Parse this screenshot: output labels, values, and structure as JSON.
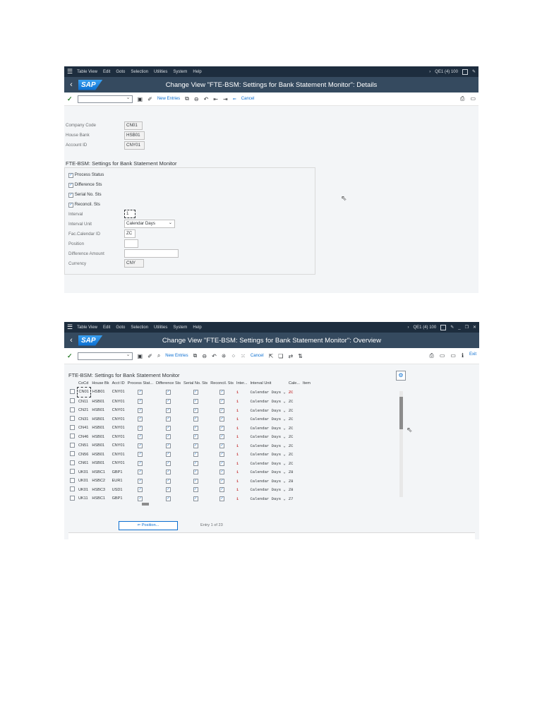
{
  "screen1": {
    "menu": [
      "Table View",
      "Edit",
      "Goto",
      "Selection",
      "Utilities",
      "System",
      "Help"
    ],
    "system_info": "QE1 (4) 100",
    "title": "Change View \"FTE-BSM: Settings for Bank Statement Monitor\": Details",
    "logo": "SAP",
    "toolbar": {
      "new_entries": "New Entries",
      "cancel": "Cancel"
    },
    "header_fields": [
      {
        "label": "Company Code",
        "value": "CN01"
      },
      {
        "label": "House Bank",
        "value": "HSB01"
      },
      {
        "label": "Account ID",
        "value": "CNY01"
      }
    ],
    "group_title": "FTE-BSM: Settings for Bank Statement Monitor",
    "checkboxes": [
      {
        "label": "Process Status",
        "checked": true
      },
      {
        "label": "Difference Sts",
        "checked": true
      },
      {
        "label": "Serial No. Sts",
        "checked": true
      },
      {
        "label": "Reconcil. Sts",
        "checked": true
      }
    ],
    "fields": {
      "interval": {
        "label": "Interval",
        "value": "1"
      },
      "interval_unit": {
        "label": "Interval Unit",
        "value": "Calendar Days"
      },
      "fac_calendar": {
        "label": "Fac.Calendar ID",
        "value": "ZC"
      },
      "position": {
        "label": "Position",
        "value": ""
      },
      "difference_amount": {
        "label": "Difference Amount",
        "value": ""
      },
      "currency": {
        "label": "Currency",
        "value": "CNY"
      }
    }
  },
  "screen2": {
    "menu": [
      "Table View",
      "Edit",
      "Goto",
      "Selection",
      "Utilities",
      "System",
      "Help"
    ],
    "system_info": "QE1 (4) 100",
    "title": "Change View \"FTE-BSM: Settings for Bank Statement Monitor\": Overview",
    "logo": "SAP",
    "toolbar": {
      "new_entries": "New Entries",
      "cancel": "Cancel",
      "exit": "Exit"
    },
    "table_title": "FTE-BSM: Settings for Bank Statement Monitor",
    "columns": [
      "CoCd",
      "House Bk",
      "Acct ID",
      "Process Stat...",
      "Difference Sts",
      "Serial No. Sts",
      "Reconcil. Sts",
      "Inter...",
      "Interval Unit",
      "Cale...",
      "Item"
    ],
    "rows": [
      [
        "CN01",
        "HSB01",
        "CNY01",
        "1",
        "Calendar Days",
        "ZC"
      ],
      [
        "CN11",
        "HSB01",
        "CNY01",
        "1",
        "Calendar Days",
        "ZC"
      ],
      [
        "CN21",
        "HSB01",
        "CNY01",
        "1",
        "Calendar Days",
        "ZC"
      ],
      [
        "CN31",
        "HSB01",
        "CNY01",
        "1",
        "Calendar Days",
        "ZC"
      ],
      [
        "CN41",
        "HSB01",
        "CNY01",
        "1",
        "Calendar Days",
        "ZC"
      ],
      [
        "CN46",
        "HSB01",
        "CNY01",
        "1",
        "Calendar Days",
        "ZC"
      ],
      [
        "CN51",
        "HSB01",
        "CNY01",
        "1",
        "Calendar Days",
        "ZC"
      ],
      [
        "CN56",
        "HSB01",
        "CNY01",
        "1",
        "Calendar Days",
        "ZC"
      ],
      [
        "CN61",
        "HSB01",
        "CNY01",
        "1",
        "Calendar Days",
        "ZC"
      ],
      [
        "UK01",
        "HSBC1",
        "GBP1",
        "1",
        "Calendar Days",
        "Z8"
      ],
      [
        "UK01",
        "HSBC2",
        "EUR1",
        "1",
        "Calendar Days",
        "Z8"
      ],
      [
        "UK01",
        "HSBC3",
        "USD1",
        "1",
        "Calendar Days",
        "Z8"
      ],
      [
        "UK11",
        "HSBC1",
        "GBP1",
        "1",
        "Calendar Days",
        "Z7"
      ]
    ],
    "position_button": "Position...",
    "entry_text": "Entry 1 of 23"
  }
}
